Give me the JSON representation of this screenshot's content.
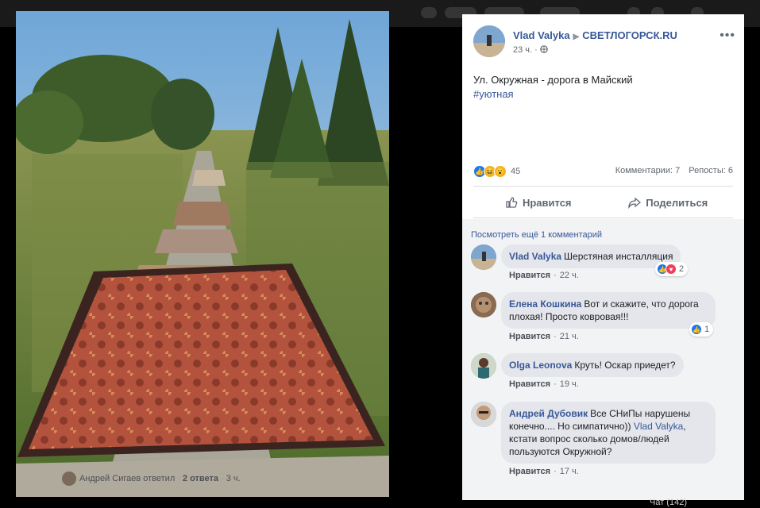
{
  "post": {
    "author": "Vlad Valyka",
    "group": "СВЕТЛОГОРСК.RU",
    "time": "23 ч.",
    "privacy_icon": "globe-icon",
    "text": "Ул. Окружная - дорога в Майский",
    "hashtag": "#уютная",
    "reaction_count": "45",
    "comments_count": "Комментарии: 7",
    "shares_count": "Репосты: 6",
    "like_label": "Нравится",
    "share_label": "Поделиться",
    "more_label": "•••"
  },
  "view_more": "Посмотреть ещё 1 комментарий",
  "comments": [
    {
      "author": "Vlad Valyka",
      "text": "Шерстяная инсталляция",
      "like": "Нравится",
      "time": "22 ч.",
      "reactions": "2"
    },
    {
      "author": "Елена Кошкина",
      "text": "Вот и скажите, что дорога плохая! Просто ковровая!!!",
      "like": "Нравится",
      "time": "21 ч.",
      "reactions": "1"
    },
    {
      "author": "Olga Leonova",
      "text": "Круть! Оскар приедет?",
      "like": "Нравится",
      "time": "19 ч."
    },
    {
      "author": "Андрей Дубовик",
      "text_before": "Все СНиПы нарушены конечно.... Но симпатично))",
      "mention": "Vlad Valyka",
      "text_after": ", кстати вопрос сколько домов/людей пользуются Окружной?",
      "like": "Нравится",
      "time": "17 ч."
    }
  ],
  "replies": {
    "text": "Андрей Сигаев ответил",
    "count": "2 ответа",
    "time": "3 ч."
  },
  "chat": "Чат (142)",
  "colors": {
    "link": "#385898",
    "panel_bg": "#ffffff",
    "comment_bubble": "#e4e6eb",
    "like_blue": "#1877f2"
  }
}
